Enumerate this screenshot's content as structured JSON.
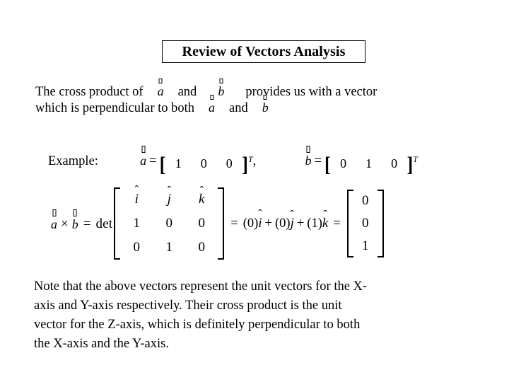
{
  "slide": {
    "background_color": "#ffffff",
    "text_color": "#000000",
    "title": "Review of Vectors Analysis"
  },
  "intro": {
    "line1_part1": "The cross product of",
    "line1_vector_a": "a",
    "line1_part2": "and",
    "line1_vector_b": "b",
    "line1_part3": "provides us with a vector",
    "line2_part1": "which is perpendicular to both",
    "line2_vector_a": "a",
    "line2_part2": "and",
    "line2_vector_b": "b"
  },
  "example": {
    "label": "Example:",
    "vector_a_symbol": "a",
    "equals": "=",
    "a_components": [
      "1",
      "0",
      "0"
    ],
    "transpose": "T",
    "comma": ",",
    "vector_b_symbol": "b",
    "b_components": [
      "0",
      "1",
      "0"
    ],
    "bracket_open": "[",
    "bracket_close": "]"
  },
  "equation": {
    "vector_a_symbol": "a",
    "cross_symbol": "×",
    "vector_b_symbol": "b",
    "equals": "=",
    "det_label": "det",
    "matrix_rows": [
      [
        "i",
        "j",
        "k"
      ],
      [
        "1",
        "0",
        "0"
      ],
      [
        "0",
        "1",
        "0"
      ]
    ],
    "hat_accent": "ˆ",
    "equals2": "=",
    "expansion": {
      "term1_coefficient": "(0)",
      "term1_unit": "i",
      "plus1": "+",
      "term2_coefficient": "(0)",
      "term2_unit": "j",
      "plus2": "+",
      "term3_coefficient": "(1)",
      "term3_unit": "k"
    },
    "equals3": "=",
    "result_vector": [
      "0",
      "0",
      "1"
    ]
  },
  "note": {
    "line1": "Note that the above vectors represent the unit vectors for the X-",
    "line2": "axis and Y-axis respectively. Their cross product is the unit",
    "line3": "vector for the Z-axis, which is definitely perpendicular to both",
    "line4": "the X-axis and the Y-axis."
  }
}
